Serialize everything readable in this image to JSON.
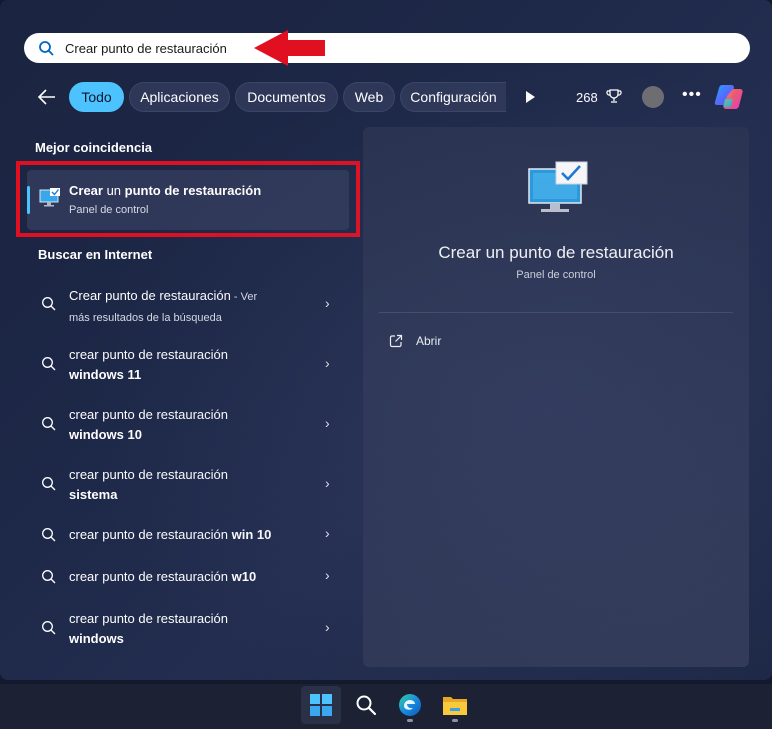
{
  "search": {
    "query": "Crear punto de restauración"
  },
  "filters": {
    "chips": [
      "Todo",
      "Aplicaciones",
      "Documentos",
      "Web",
      "Configuración"
    ],
    "active": "Todo",
    "points": "268"
  },
  "left": {
    "best_header": "Mejor coincidencia",
    "best": {
      "title_a": "Crear",
      "title_b": " un ",
      "title_c": "punto de restauración",
      "subtitle": "Panel de control"
    },
    "internet_header": "Buscar en Internet",
    "results": [
      {
        "line1": "Crear punto de restauración",
        "line1_suffix": " - Ver",
        "line2": "más resultados de la búsqueda"
      },
      {
        "line1": "crear punto de restauración",
        "line2": "windows 11"
      },
      {
        "line1": "crear punto de restauración",
        "line2": "windows 10"
      },
      {
        "line1": "crear punto de restauración",
        "line2": "sistema"
      },
      {
        "line1": "crear punto de restauración",
        "line1_bold": " win 10"
      },
      {
        "line1": "crear punto de restauración",
        "line1_bold": " w10"
      },
      {
        "line1": "crear punto de restauración",
        "line2": "windows"
      }
    ]
  },
  "right": {
    "title": "Crear un punto de restauración",
    "subtitle": "Panel de control",
    "action": "Abrir"
  },
  "colors": {
    "accent": "#4cc2ff",
    "highlight_box": "#e01020",
    "arrow": "#e01020"
  },
  "icons": [
    "search-icon",
    "back-arrow-icon",
    "play-icon",
    "trophy-icon",
    "more-icon",
    "copilot-icon",
    "monitor-check-icon",
    "open-external-icon",
    "chevron-right-icon",
    "windows-start-icon",
    "edge-icon",
    "file-explorer-icon"
  ]
}
